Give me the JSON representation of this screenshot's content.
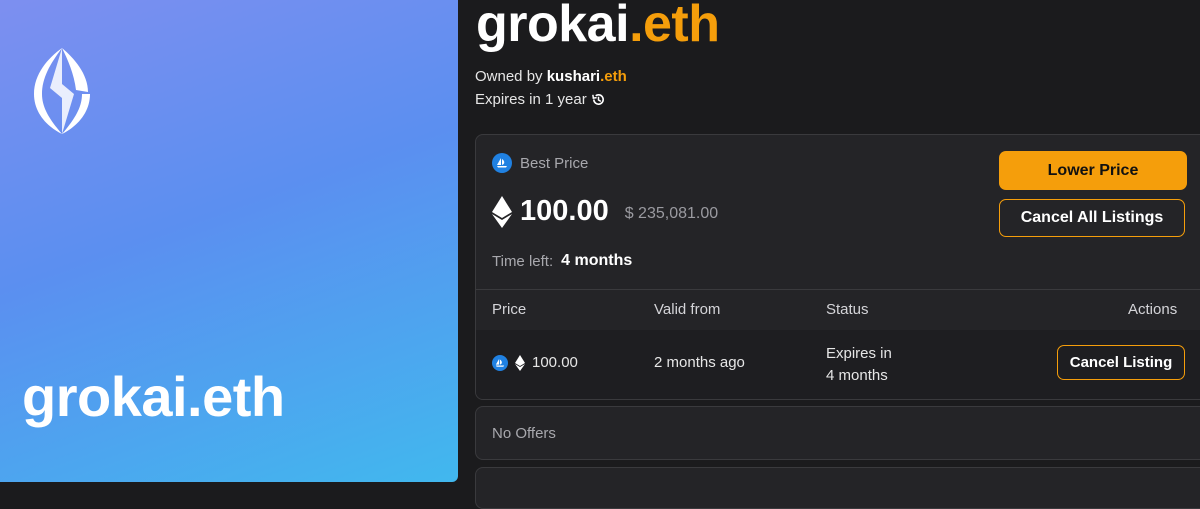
{
  "hero": {
    "name": "grokai.eth"
  },
  "domain": {
    "label": "grokai",
    "tld": ".eth"
  },
  "owner": {
    "prefix": "Owned by",
    "name": "kushari",
    "tld": ".eth"
  },
  "expiry": {
    "text": "Expires in 1 year"
  },
  "listing": {
    "best_label": "Best Price",
    "price": "100.00",
    "usd": "$ 235,081.00",
    "time_left_label": "Time left:",
    "time_left_value": "4 months",
    "lower_button": "Lower Price",
    "cancel_all_button": "Cancel All Listings"
  },
  "table": {
    "headers": [
      "Price",
      "Valid from",
      "Status",
      "Actions"
    ],
    "rows": [
      {
        "price": "100.00",
        "valid_from": "2 months ago",
        "status_line1": "Expires in",
        "status_line2": "4 months",
        "action": "Cancel Listing"
      }
    ]
  },
  "offers": {
    "empty_text": "No Offers"
  },
  "colors": {
    "accent": "#f59e0b",
    "opensea": "#2081e2",
    "background": "#1b1b1d"
  }
}
